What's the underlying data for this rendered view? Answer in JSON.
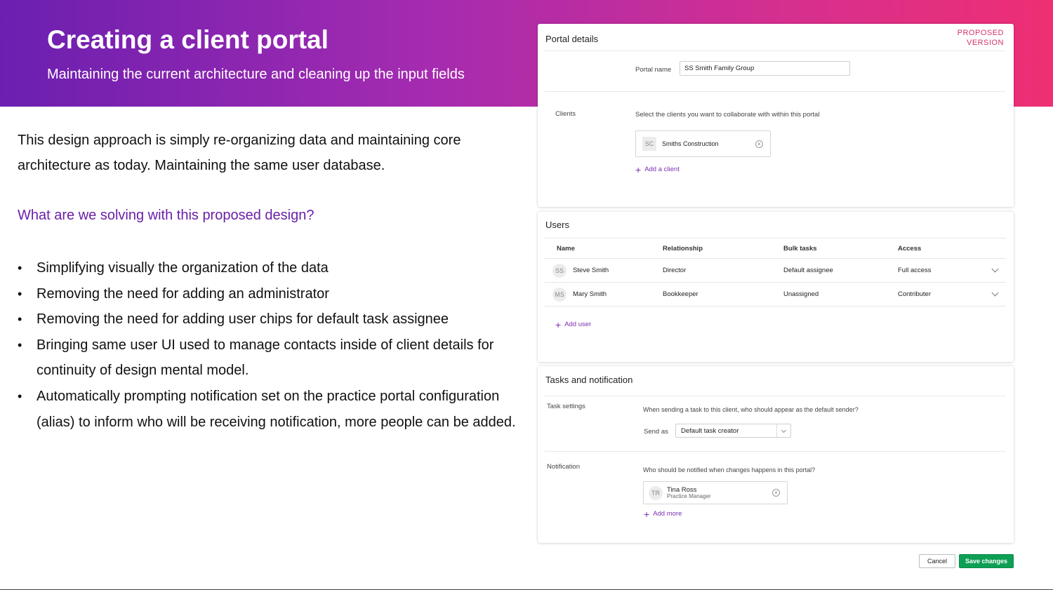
{
  "hero": {
    "title": "Creating a client portal",
    "subtitle": "Maintaining the current architecture and cleaning up the input fields"
  },
  "intro": "This design approach is simply re-organizing data and maintaining core architecture as today. Maintaining the same user database.",
  "question": "What are we solving with this proposed design?",
  "bullets": [
    "Simplifying visually the organization of the data",
    "Removing the need for adding an administrator",
    "Removing the need for adding user chips for default task assignee",
    "Bringing same user UI used to manage contacts inside of client details for continuity of design mental model.",
    "Automatically prompting notification set on the practice portal configuration (alias) to inform who will be receiving notification, more people can be added."
  ],
  "portal_details": {
    "title": "Portal details",
    "badge_line1": "PROPOSED",
    "badge_line2": "VERSION",
    "portal_name_label": "Portal name",
    "portal_name_value": "SS Smith Family Group",
    "clients_label": "Clients",
    "clients_hint": "Select the clients you want to collaborate with within this portal",
    "client_chip": {
      "initials": "SC",
      "name": "Smiths Construction"
    },
    "add_client": "Add a client"
  },
  "users": {
    "title": "Users",
    "columns": [
      "Name",
      "Relationship",
      "Bulk tasks",
      "Access"
    ],
    "rows": [
      {
        "initials": "SS",
        "name": "Steve Smith",
        "relationship": "Director",
        "bulk_tasks": "Default assignee",
        "access": "Full access"
      },
      {
        "initials": "MS",
        "name": "Mary Smith",
        "relationship": "Bookkeeper",
        "bulk_tasks": "Unassigned",
        "access": "Contributer"
      }
    ],
    "add_user": "Add user"
  },
  "tasks": {
    "title": "Tasks and notification",
    "task_settings_label": "Task settings",
    "task_settings_hint": "When sending a task to this client, who should appear as the default sender?",
    "send_as_label": "Send as",
    "send_as_value": "Default task creator",
    "notification_label": "Notification",
    "notification_hint": "Who should be notified when changes happens in this portal?",
    "notify_chip": {
      "initials": "TR",
      "name": "Tina Ross",
      "role": "Practice Manager"
    },
    "add_more": "Add more"
  },
  "actions": {
    "cancel": "Cancel",
    "save": "Save changes"
  },
  "colors": {
    "accent_purple": "#6a1fa8",
    "accent_pink": "#d63165",
    "save_green": "#0e9f54"
  }
}
